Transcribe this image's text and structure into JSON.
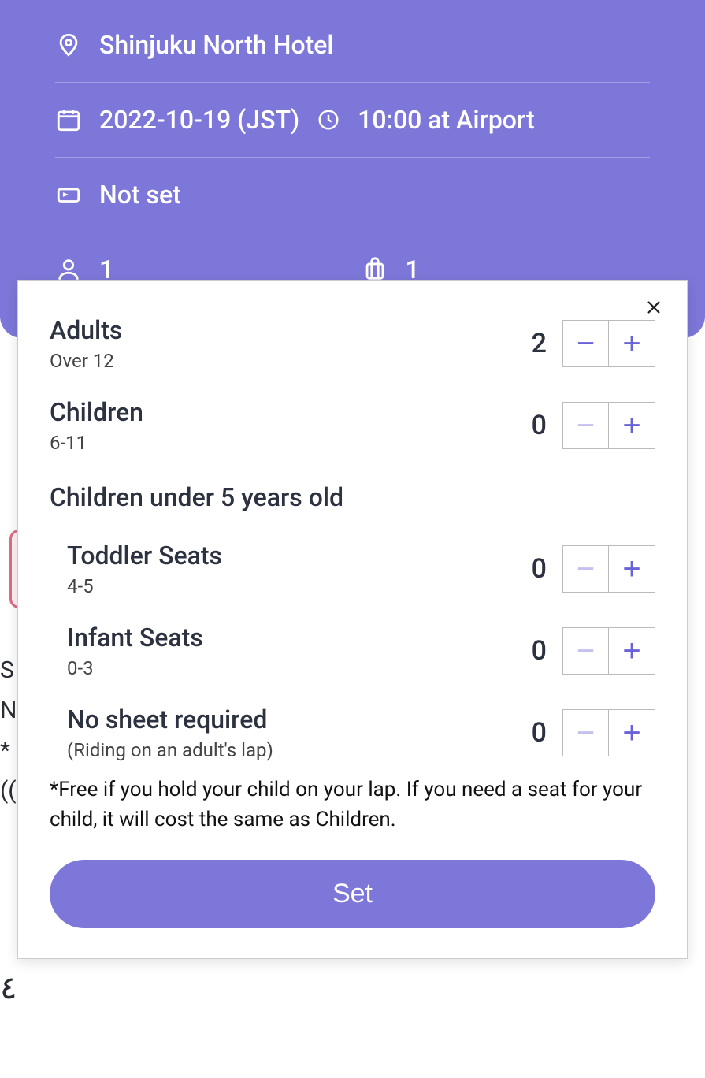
{
  "header": {
    "location": "Shinjuku North Hotel",
    "date": "2022-10-19 (JST)",
    "time": "10:00 at Airport",
    "flight": "Not set",
    "persons": "1",
    "luggage": "1"
  },
  "modal": {
    "adults": {
      "title": "Adults",
      "sub": "Over 12",
      "value": "2",
      "minus_disabled": false
    },
    "children": {
      "title": "Children",
      "sub": "6-11",
      "value": "0",
      "minus_disabled": true
    },
    "section": "Children under 5 years old",
    "toddler": {
      "title": "Toddler Seats",
      "sub": "4-5",
      "value": "0",
      "minus_disabled": true
    },
    "infant": {
      "title": "Infant Seats",
      "sub": "0-3",
      "value": "0",
      "minus_disabled": true
    },
    "nosheet": {
      "title": "No sheet required",
      "sub": "(Riding on an adult's lap)",
      "value": "0",
      "minus_disabled": true
    },
    "note": "*Free if you hold your child on your lap. If you need a seat for your child, it will cost the same as Children.",
    "set_label": "Set"
  },
  "bg": {
    "line1": "S",
    "line2": "N",
    "line3": "*",
    "line4": "((",
    "line5": "٤"
  }
}
